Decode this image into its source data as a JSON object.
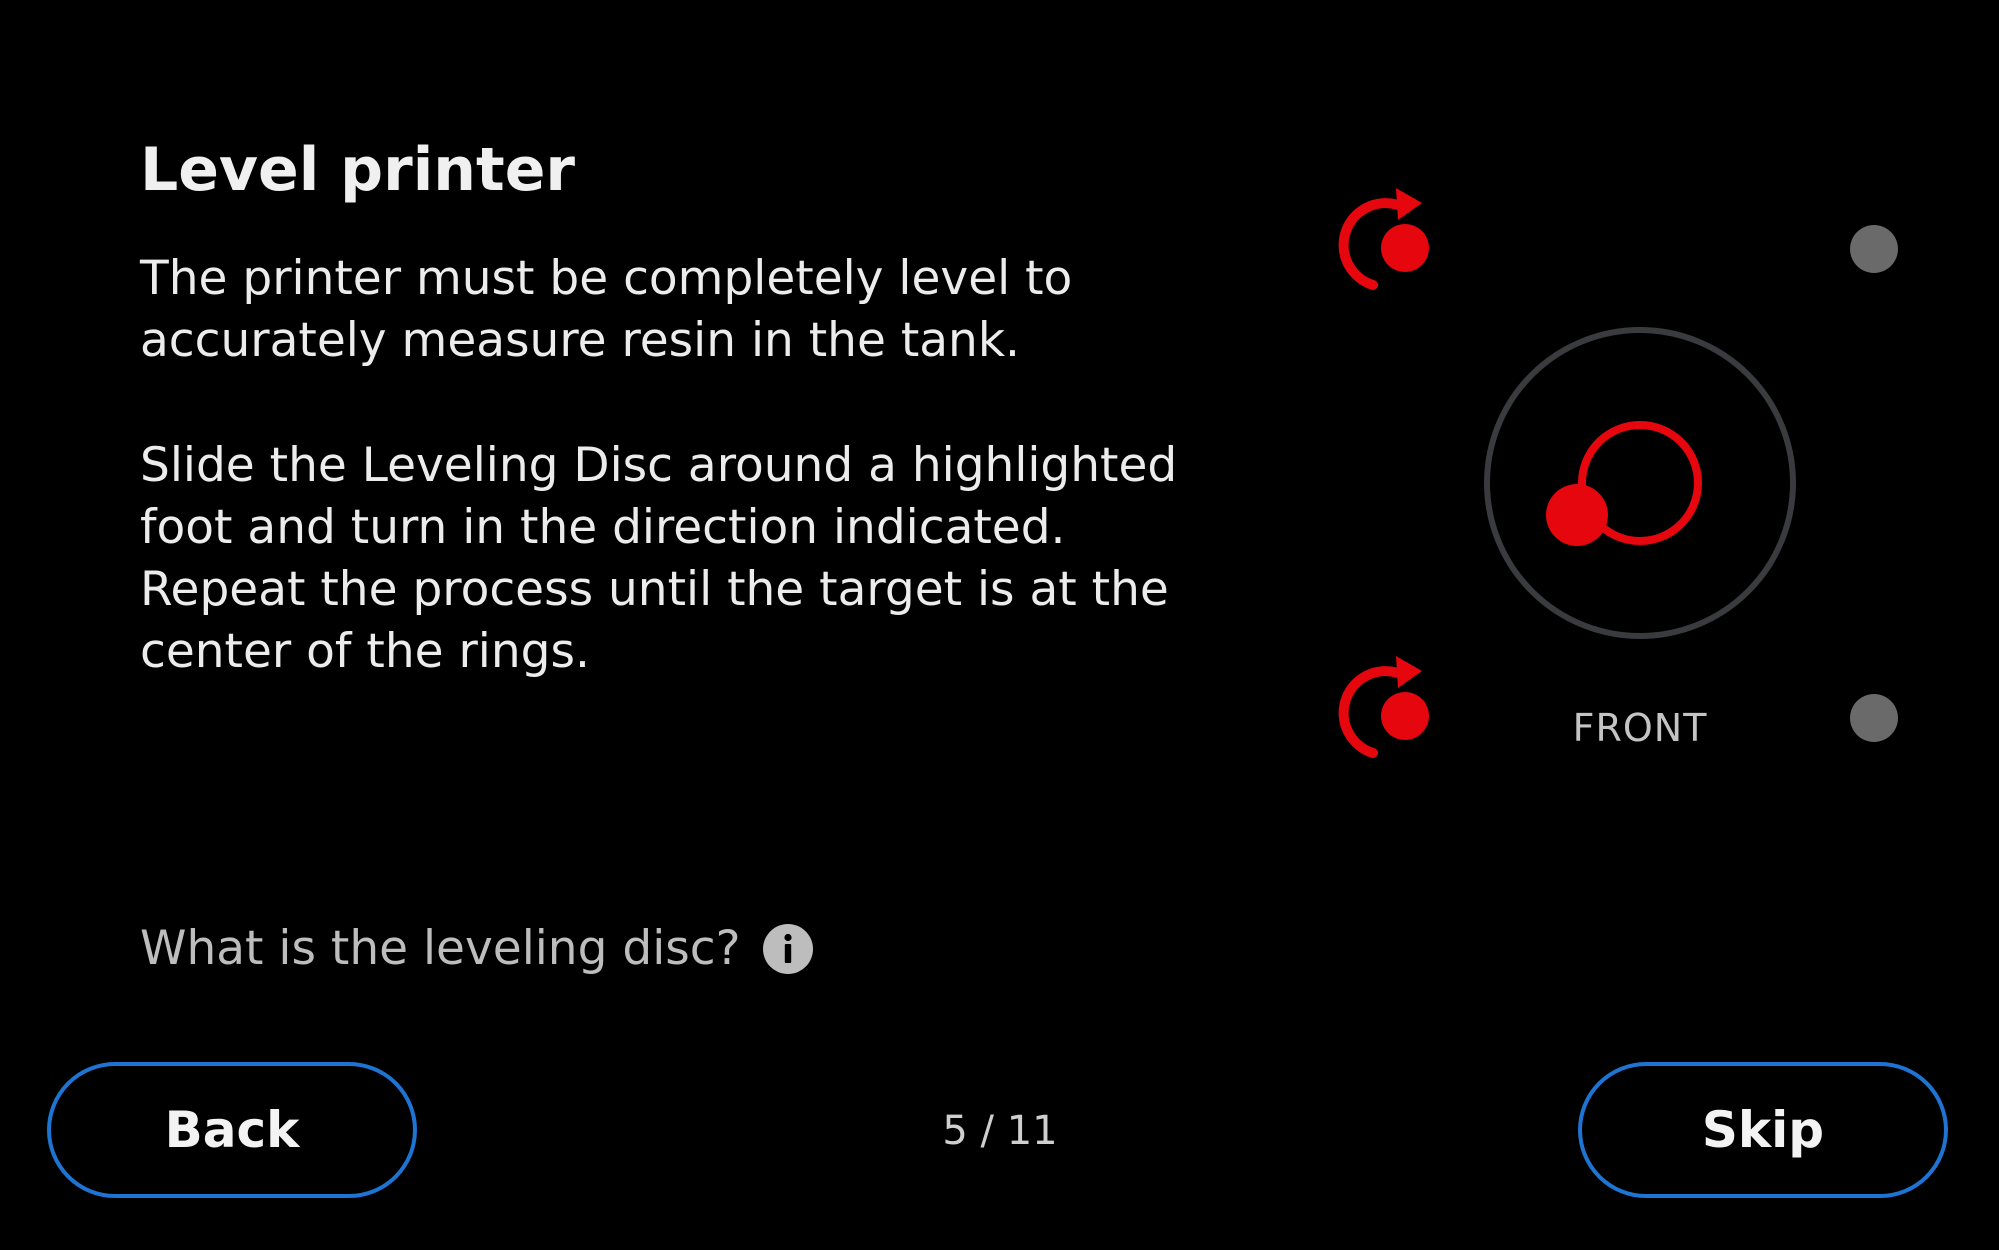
{
  "content": {
    "title": "Level printer",
    "paragraph_1": "The printer must be completely level to accurately measure resin in the tank.",
    "paragraph_2": "Slide the Leveling Disc around a highlighted foot and turn in the direction indicated. Repeat the process until the target is at the center of the rings.",
    "help_link": "What is the leveling disc?",
    "help_icon": "info-icon"
  },
  "diagram": {
    "front_label": "FRONT",
    "feet": [
      {
        "name": "back-left-foot",
        "highlighted": true,
        "rotate_icon": "rotate-clockwise-arrow-icon"
      },
      {
        "name": "back-right-foot",
        "highlighted": false
      },
      {
        "name": "front-left-foot",
        "highlighted": true,
        "rotate_icon": "rotate-clockwise-arrow-icon"
      },
      {
        "name": "front-right-foot",
        "highlighted": false
      }
    ]
  },
  "navigation": {
    "back_label": "Back",
    "skip_label": "Skip",
    "page_indicator": "5 / 11"
  },
  "colors": {
    "background": "#000000",
    "accent_red": "#E5060E",
    "button_border": "#1E74D2",
    "inactive_foot": "#6A6A6A",
    "ring": "#3A3B3E"
  }
}
